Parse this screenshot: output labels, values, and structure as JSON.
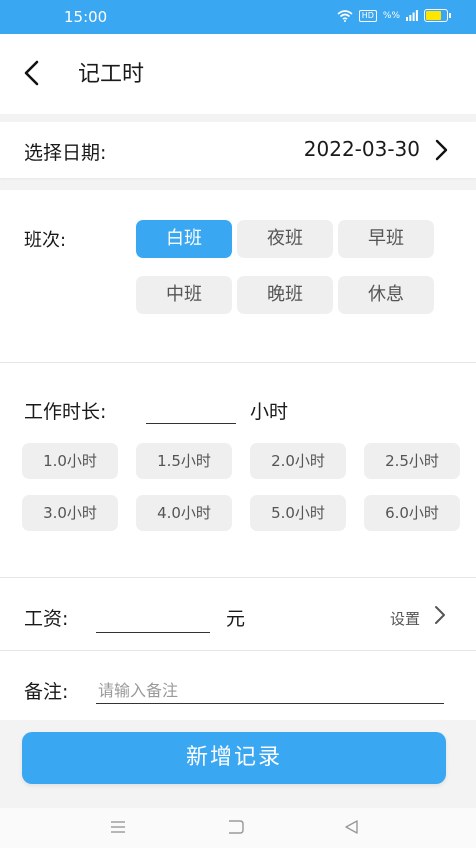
{
  "status_bar": {
    "time": "15:00",
    "signal_text": "HD",
    "network_text": "%%",
    "battery_color": "#ffe600",
    "battery_level": 0.85
  },
  "header": {
    "back_icon": "chevron-left-icon",
    "title": "记工时"
  },
  "date_row": {
    "label": "选择日期:",
    "value": "2022-03-30",
    "chevron_icon": "chevron-right-icon"
  },
  "shift": {
    "label": "班次:",
    "options": [
      "白班",
      "夜班",
      "早班",
      "中班",
      "晚班",
      "休息"
    ],
    "selected": "白班"
  },
  "hours": {
    "label": "工作时长:",
    "value": "",
    "unit": "小时",
    "presets": [
      "1.0小时",
      "1.5小时",
      "2.0小时",
      "2.5小时",
      "3.0小时",
      "4.0小时",
      "5.0小时",
      "6.0小时"
    ]
  },
  "wage": {
    "label": "工资:",
    "value": "",
    "unit": "元",
    "setting_label": "设置",
    "chevron_icon": "chevron-right-icon"
  },
  "note": {
    "label": "备注:",
    "value": "",
    "placeholder": "请输入备注"
  },
  "submit": {
    "label": "新增记录"
  },
  "colors": {
    "accent": "#3aa7f2",
    "chip_bg": "#efefef"
  },
  "nav_bar": {
    "icons": [
      "menu-icon",
      "home-icon",
      "back-triangle-icon"
    ]
  }
}
